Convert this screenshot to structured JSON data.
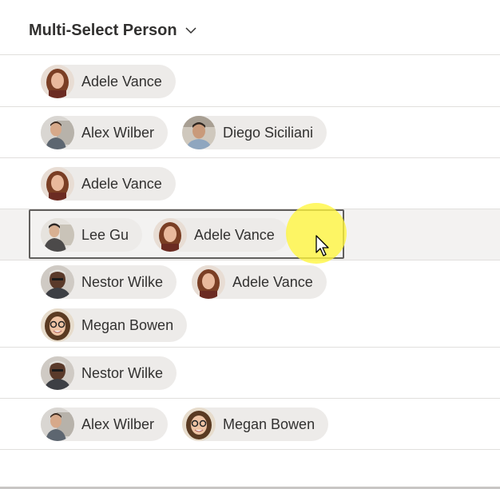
{
  "header": {
    "title": "Multi-Select Person",
    "dropdown_icon": "chevron-down-icon"
  },
  "rows": [
    {
      "people": [
        "Adele Vance"
      ]
    },
    {
      "people": [
        "Alex Wilber",
        "Diego Siciliani"
      ]
    },
    {
      "people": [
        "Adele Vance"
      ]
    },
    {
      "people": [
        "Lee Gu",
        "Adele Vance"
      ],
      "selected": true
    },
    {
      "people": [
        "Nestor Wilke",
        "Adele Vance",
        "Megan Bowen"
      ]
    },
    {
      "people": [
        "Nestor Wilke"
      ]
    },
    {
      "people": [
        "Alex Wilber",
        "Megan Bowen"
      ]
    }
  ],
  "colors": {
    "chip_background": "#edebe9",
    "selected_row_background": "#f3f2f1",
    "click_highlight": "#fff63c"
  }
}
